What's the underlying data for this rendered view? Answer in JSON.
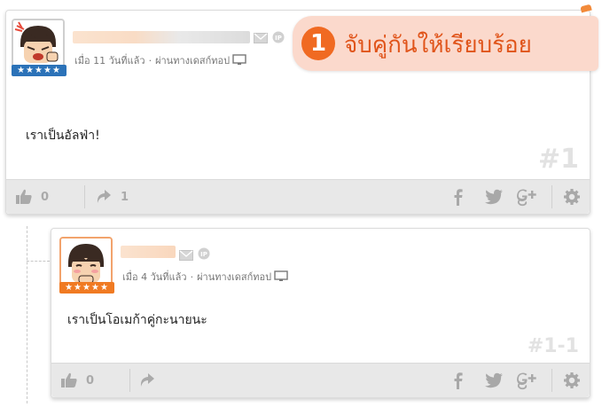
{
  "banner": {
    "number": "1",
    "text": "จับคู่กันให้เรียบร้อย"
  },
  "posts": [
    {
      "stars_text": "★★★★★",
      "meta_time": "เมื่อ 11 วันที่แล้ว",
      "meta_via": "ผ่านทางเดสก์ทอป",
      "body": "เราเป็นอัลฟ่า!",
      "number": "#1",
      "like_count": "0",
      "share_count": "1"
    },
    {
      "stars_text": "★★★★★",
      "meta_time": "เมื่อ 4 วันที่แล้ว",
      "meta_via": "ผ่านทางเดสก์ทอป",
      "body": "เราเป็นโอเมก้าคู่กะนายนะ",
      "number": "#1-1",
      "like_count": "0"
    }
  ],
  "meta_separator": "·",
  "colors": {
    "accent": "#f06a22",
    "banner_bg": "#fbd9cc",
    "star_blue": "#2b72b8",
    "star_orange": "#f07a22",
    "footer_bg": "#e8e8e8"
  },
  "icons": [
    "thumbs-up-icon",
    "share-icon",
    "facebook-icon",
    "twitter-icon",
    "google-plus-icon",
    "gear-icon",
    "envelope-icon",
    "ip-icon",
    "monitor-icon"
  ]
}
